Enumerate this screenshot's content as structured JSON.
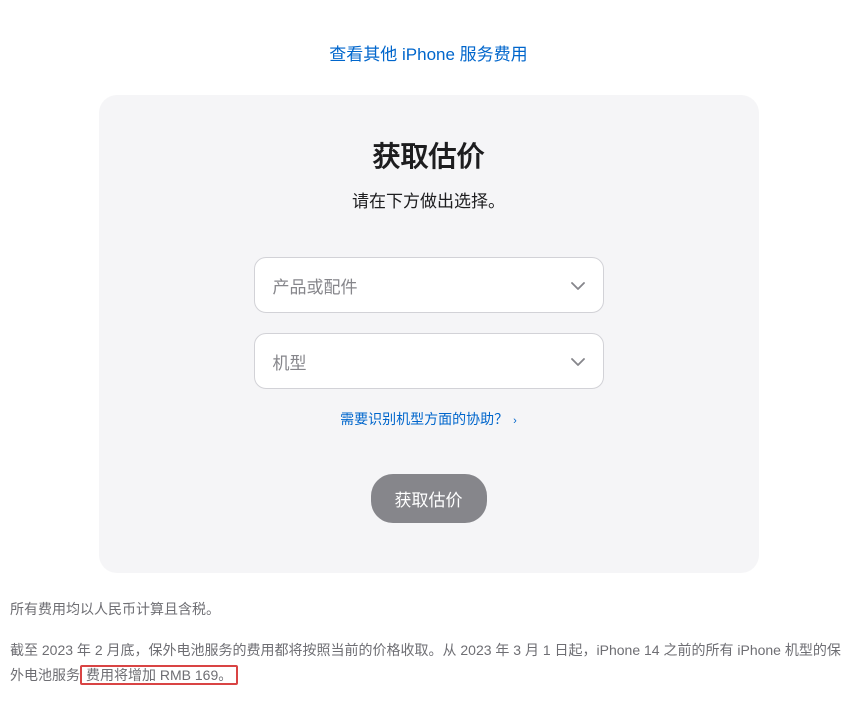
{
  "topLink": {
    "label": "查看其他 iPhone 服务费用"
  },
  "card": {
    "title": "获取估价",
    "subtitle": "请在下方做出选择。",
    "select1": {
      "placeholder": "产品或配件"
    },
    "select2": {
      "placeholder": "机型"
    },
    "helpLink": {
      "label": "需要识别机型方面的协助？"
    },
    "submit": {
      "label": "获取估价"
    }
  },
  "footer": {
    "line1": "所有费用均以人民币计算且含税。",
    "line2_prefix": "截至 2023 年 2 月底，保外电池服务的费用都将按照当前的价格收取。从 2023 年 3 月 1 日起，iPhone 14 之前的所有 iPhone 机型的保外电池服务",
    "line2_highlight": "费用将增加 RMB 169。"
  }
}
